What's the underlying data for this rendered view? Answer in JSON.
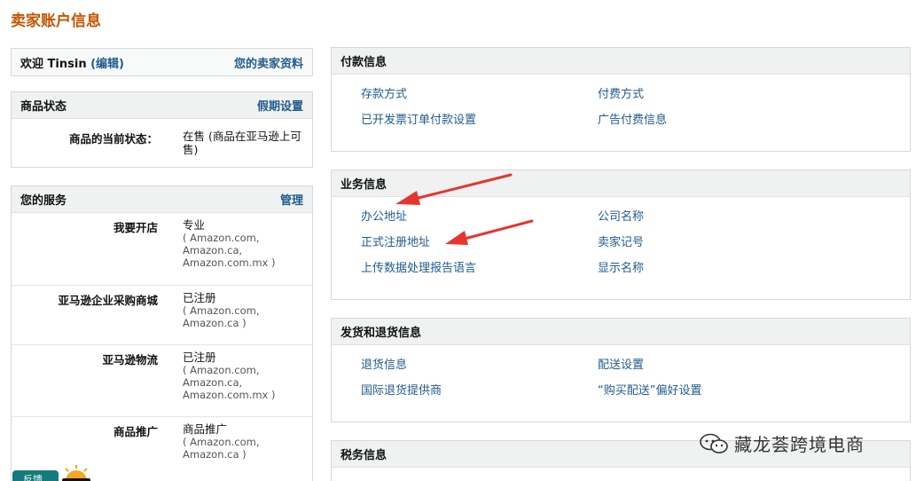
{
  "page_title": "卖家账户信息",
  "welcome": {
    "prefix": "欢迎",
    "user": "Tinsin",
    "edit": "(编辑)",
    "profile_link": "您的卖家资料"
  },
  "listing_status": {
    "title": "商品状态",
    "action": "假期设置",
    "label": "商品的当前状态：",
    "value": "在售 (商品在亚马逊上可售)"
  },
  "services": {
    "title": "您的服务",
    "action": "管理",
    "rows": [
      {
        "key": "我要开店",
        "value": "专业",
        "sub": [
          "( Amazon.com,",
          "Amazon.ca,",
          "Amazon.com.mx )"
        ]
      },
      {
        "key": "亚马逊企业采购商城",
        "value": "已注册",
        "sub": [
          "( Amazon.com,",
          "Amazon.ca )"
        ]
      },
      {
        "key": "亚马逊物流",
        "value": "已注册",
        "sub": [
          "( Amazon.com,",
          "Amazon.ca,",
          "Amazon.com.mx )"
        ]
      },
      {
        "key": "商品推广",
        "value": "商品推广",
        "sub": [
          "( Amazon.com,",
          "Amazon.ca )"
        ]
      }
    ]
  },
  "payment": {
    "title": "付款信息",
    "links": [
      "存款方式",
      "付费方式",
      "已开发票订单付款设置",
      "广告付费信息"
    ]
  },
  "business": {
    "title": "业务信息",
    "links": [
      "办公地址",
      "公司名称",
      "正式注册地址",
      "卖家记号",
      "上传数据处理报告语言",
      "显示名称"
    ]
  },
  "shipping": {
    "title": "发货和退货信息",
    "links": [
      "退货信息",
      "配送设置",
      "国际退货提供商",
      "“购买配送”偏好设置"
    ]
  },
  "tax": {
    "title": "税务信息"
  },
  "watermark": "藏龙荟跨境电商",
  "feedback": "反馈",
  "colors": {
    "title": "#c45500",
    "link": "#1f5b8f",
    "arrow": "#e8342e",
    "header_bg": "#f0f2f2"
  }
}
